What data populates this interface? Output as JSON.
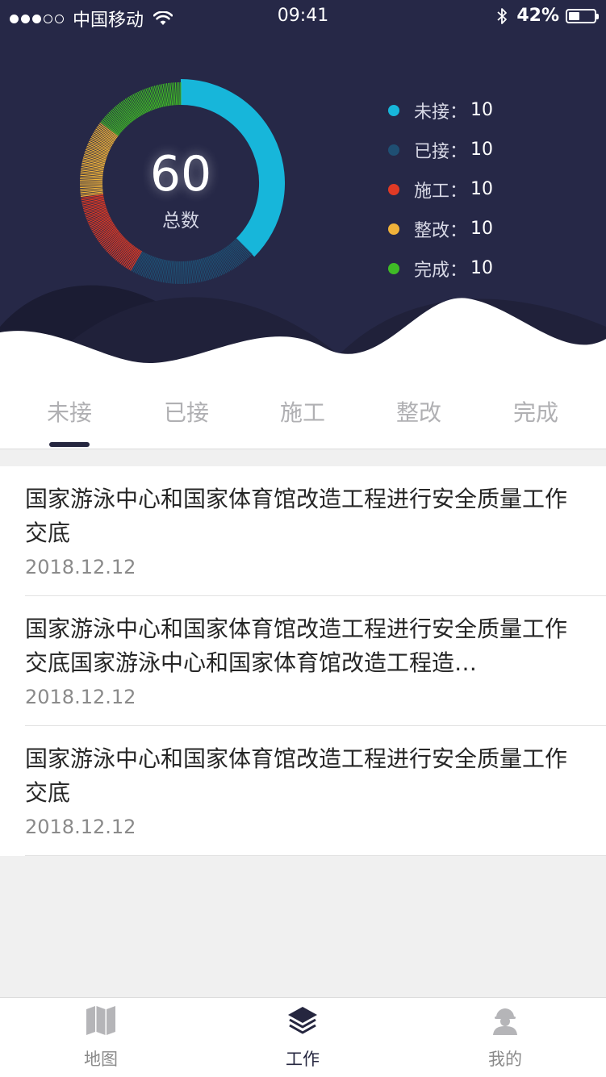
{
  "status_bar": {
    "carrier": "中国移动",
    "time": "09:41",
    "battery": "42%",
    "battery_level": 0.42
  },
  "summary": {
    "total_value": "60",
    "total_label": "总数",
    "legend": [
      {
        "label": "未接",
        "colon": "：",
        "value": "10",
        "color": "#17b6da"
      },
      {
        "label": "已接",
        "colon": "：",
        "value": "10",
        "color": "#1f4f73"
      },
      {
        "label": "施工",
        "colon": "：",
        "value": "10",
        "color": "#e03a25"
      },
      {
        "label": "整改",
        "colon": "：",
        "value": "10",
        "color": "#f0b23a"
      },
      {
        "label": "完成",
        "colon": "：",
        "value": "10",
        "color": "#3fbb26"
      }
    ],
    "ring_shares": [
      {
        "label": "未接",
        "fraction": 0.375,
        "color": "#17b6da",
        "solid": true
      },
      {
        "label": "已接",
        "fraction": 0.2083,
        "color": "#1f4f73",
        "solid": false
      },
      {
        "label": "施工",
        "fraction": 0.1458,
        "color": "#e03a25",
        "solid": false
      },
      {
        "label": "整改",
        "fraction": 0.125,
        "color": "#f0b23a",
        "solid": false
      },
      {
        "label": "完成",
        "fraction": 0.1458,
        "color": "#3fbb26",
        "solid": false
      }
    ]
  },
  "tabs": [
    {
      "label": "未接",
      "active": true
    },
    {
      "label": "已接",
      "active": false
    },
    {
      "label": "施工",
      "active": false
    },
    {
      "label": "整改",
      "active": false
    },
    {
      "label": "完成",
      "active": false
    }
  ],
  "list": [
    {
      "title": "国家游泳中心和国家体育馆改造工程进行安全质量工作交底",
      "date": "2018.12.12"
    },
    {
      "title": "国家游泳中心和国家体育馆改造工程进行安全质量工作交底国家游泳中心和国家体育馆改造工程造…",
      "date": "2018.12.12"
    },
    {
      "title": "国家游泳中心和国家体育馆改造工程进行安全质量工作交底",
      "date": "2018.12.12"
    }
  ],
  "tabbar": [
    {
      "label": "地图",
      "icon": "map-icon",
      "active": false
    },
    {
      "label": "工作",
      "icon": "layers-icon",
      "active": true
    },
    {
      "label": "我的",
      "icon": "user-icon",
      "active": false
    }
  ],
  "colors": {
    "header_bg": "#262847",
    "active_text": "#25263f",
    "inactive_text": "#b0b0b3"
  }
}
